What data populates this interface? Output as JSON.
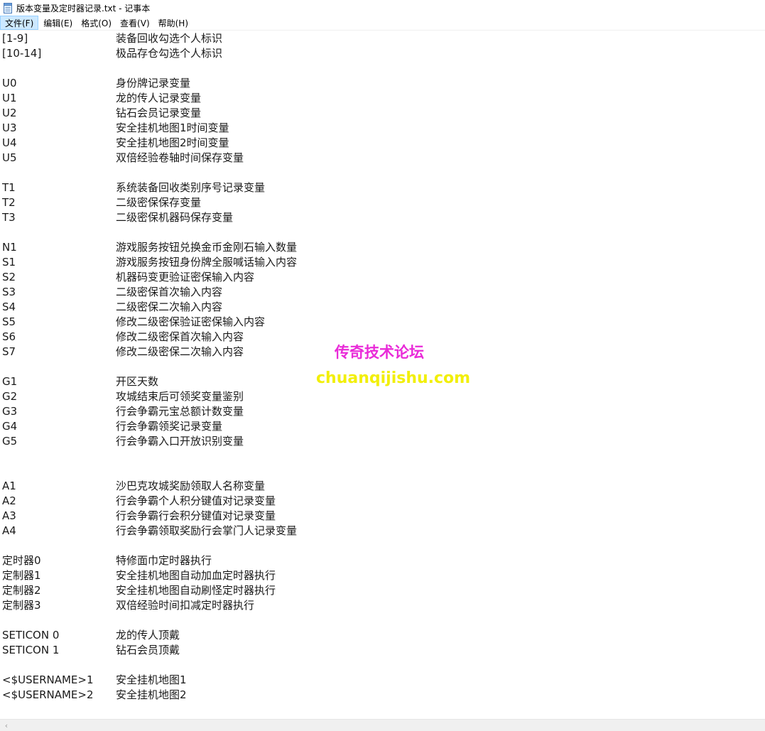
{
  "window": {
    "title": "版本变量及定时器记录.txt - 记事本"
  },
  "menu": [
    {
      "label": "文件(F)"
    },
    {
      "label": "编辑(E)"
    },
    {
      "label": "格式(O)"
    },
    {
      "label": "查看(V)"
    },
    {
      "label": "帮助(H)"
    }
  ],
  "lines": [
    {
      "key": "[1-9]",
      "value": "装备回收勾选个人标识"
    },
    {
      "key": "[10-14]",
      "value": "极品存仓勾选个人标识"
    },
    {
      "key": "",
      "value": ""
    },
    {
      "key": "U0",
      "value": "身份牌记录变量"
    },
    {
      "key": "U1",
      "value": "龙的传人记录变量"
    },
    {
      "key": "U2",
      "value": "钻石会员记录变量"
    },
    {
      "key": "U3",
      "value": "安全挂机地图1时间变量"
    },
    {
      "key": "U4",
      "value": "安全挂机地图2时间变量"
    },
    {
      "key": "U5",
      "value": "双倍经验卷轴时间保存变量"
    },
    {
      "key": "",
      "value": ""
    },
    {
      "key": "T1",
      "value": "系统装备回收类别序号记录变量"
    },
    {
      "key": "T2",
      "value": "二级密保保存变量"
    },
    {
      "key": "T3",
      "value": "二级密保机器码保存变量"
    },
    {
      "key": "",
      "value": ""
    },
    {
      "key": "N1",
      "value": "游戏服务按钮兑换金币金刚石输入数量"
    },
    {
      "key": "S1",
      "value": "游戏服务按钮身份牌全服喊话输入内容"
    },
    {
      "key": "S2",
      "value": "机器码变更验证密保输入内容"
    },
    {
      "key": "S3",
      "value": "二级密保首次输入内容"
    },
    {
      "key": "S4",
      "value": "二级密保二次输入内容"
    },
    {
      "key": "S5",
      "value": "修改二级密保验证密保输入内容"
    },
    {
      "key": "S6",
      "value": "修改二级密保首次输入内容"
    },
    {
      "key": "S7",
      "value": "修改二级密保二次输入内容"
    },
    {
      "key": "",
      "value": ""
    },
    {
      "key": "G1",
      "value": "开区天数"
    },
    {
      "key": "G2",
      "value": "攻城结束后可领奖变量鉴别"
    },
    {
      "key": "G3",
      "value": "行会争霸元宝总额计数变量"
    },
    {
      "key": "G4",
      "value": "行会争霸领奖记录变量"
    },
    {
      "key": "G5",
      "value": "行会争霸入口开放识别变量"
    },
    {
      "key": "",
      "value": ""
    },
    {
      "key": "",
      "value": ""
    },
    {
      "key": "A1",
      "value": "沙巴克攻城奖励领取人名称变量"
    },
    {
      "key": "A2",
      "value": "行会争霸个人积分键值对记录变量"
    },
    {
      "key": "A3",
      "value": "行会争霸行会积分键值对记录变量"
    },
    {
      "key": "A4",
      "value": "行会争霸领取奖励行会掌门人记录变量"
    },
    {
      "key": "",
      "value": ""
    },
    {
      "key": "定时器0",
      "value": "特修面巾定时器执行"
    },
    {
      "key": "定制器1",
      "value": "安全挂机地图自动加血定时器执行"
    },
    {
      "key": "定制器2",
      "value": "安全挂机地图自动刷怪定时器执行"
    },
    {
      "key": "定制器3",
      "value": "双倍经验时间扣减定时器执行"
    },
    {
      "key": "",
      "value": ""
    },
    {
      "key": "SETICON 0",
      "value": "龙的传人顶戴"
    },
    {
      "key": "SETICON 1",
      "value": "钻石会员顶戴"
    },
    {
      "key": "",
      "value": ""
    },
    {
      "key": "<$USERNAME>1",
      "value": "安全挂机地图1"
    },
    {
      "key": "<$USERNAME>2",
      "value": "安全挂机地图2"
    }
  ],
  "watermark": {
    "title": "传奇技术论坛",
    "url": "chuanqijishu.com",
    "title_color": "#e92bd8",
    "url_color": "#f2ef0a"
  },
  "scrollbar": {
    "left_arrow_icon": "chevron-left-icon"
  }
}
